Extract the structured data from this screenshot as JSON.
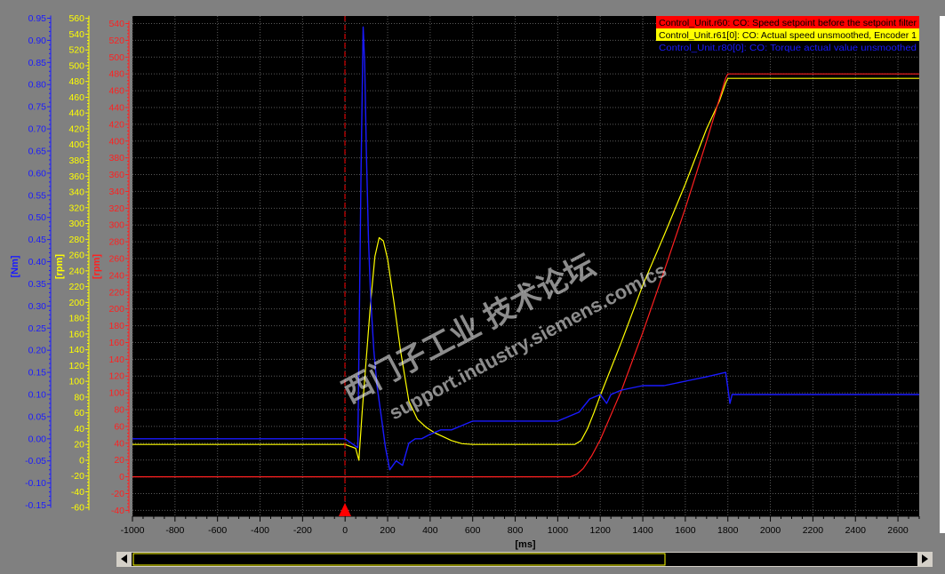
{
  "colors": {
    "background": "#808080",
    "plot_bg": "#000000",
    "grid": "#5a5a5a",
    "torque_axis": "#1a1aff",
    "speed_axis": "#ffff00",
    "setpoint_axis": "#ff2020",
    "trigger": "#ff0000",
    "scrollbar_thumb": "#000000",
    "scrollbar_frame": "#ffff00"
  },
  "axes": {
    "torque_unit": "[Nm]",
    "speed_unit": "[rpm]",
    "setpoint_unit": "[rpm]",
    "x_unit": "[ms]"
  },
  "chart_data": {
    "type": "line",
    "title": "",
    "xlabel": "[ms]",
    "xlim": [
      -1000,
      2700
    ],
    "x_ticks": [
      -1000,
      -800,
      -600,
      -400,
      -200,
      0,
      200,
      400,
      600,
      800,
      1000,
      1200,
      1400,
      1600,
      1800,
      2000,
      2200,
      2400,
      2600
    ],
    "grid": true,
    "legend_position": "top-right",
    "trigger_x": 0,
    "y_axes": [
      {
        "id": "nm",
        "label": "[Nm]",
        "ylim": [
          -0.175,
          0.955
        ],
        "ticks": [
          -0.15,
          -0.1,
          -0.05,
          0.0,
          0.05,
          0.1,
          0.15,
          0.2,
          0.25,
          0.3,
          0.35,
          0.4,
          0.45,
          0.5,
          0.55,
          0.6,
          0.65,
          0.7,
          0.75,
          0.8,
          0.85,
          0.9,
          0.95
        ],
        "decimals": 2
      },
      {
        "id": "rpm_y",
        "label": "[rpm]",
        "ylim": [
          -71,
          563
        ],
        "ticks": [
          -60,
          -40,
          -20,
          0,
          20,
          40,
          60,
          80,
          100,
          120,
          140,
          160,
          180,
          200,
          220,
          240,
          260,
          280,
          300,
          320,
          340,
          360,
          380,
          400,
          420,
          440,
          460,
          480,
          500,
          520,
          540,
          560
        ],
        "decimals": 0
      },
      {
        "id": "rpm_r",
        "label": "[rpm]",
        "ylim": [
          -47,
          549
        ],
        "ticks": [
          -40,
          -20,
          0,
          20,
          40,
          60,
          80,
          100,
          120,
          140,
          160,
          180,
          200,
          220,
          240,
          260,
          280,
          300,
          320,
          340,
          360,
          380,
          400,
          420,
          440,
          460,
          480,
          500,
          520,
          540
        ],
        "decimals": 0
      }
    ],
    "series": [
      {
        "name": "Control_Unit.r60: CO: Speed setpoint before the setpoint filter",
        "axis": "rpm_r",
        "color": "#ff2020",
        "x": [
          -1000,
          1060,
          1090,
          1120,
          1160,
          1200,
          1300,
          1400,
          1500,
          1600,
          1700,
          1790,
          1800,
          2700
        ],
        "y": [
          0,
          0,
          3,
          10,
          25,
          44,
          103,
          172,
          245,
          320,
          400,
          475,
          480,
          480
        ]
      },
      {
        "name": "Control_Unit.r61[0]: CO: Actual speed unsmoothed, Encoder 1",
        "axis": "rpm_y",
        "color": "#ffff00",
        "x": [
          -1000,
          0,
          50,
          65,
          80,
          100,
          120,
          140,
          160,
          180,
          200,
          230,
          260,
          300,
          340,
          380,
          420,
          460,
          500,
          550,
          600,
          700,
          800,
          900,
          1000,
          1080,
          1110,
          1140,
          1170,
          1200,
          1300,
          1400,
          1500,
          1600,
          1700,
          1760,
          1790,
          1800,
          2700
        ],
        "y": [
          20,
          20,
          15,
          0,
          60,
          130,
          200,
          258,
          282,
          278,
          255,
          200,
          140,
          75,
          52,
          42,
          35,
          30,
          25,
          21,
          20,
          20,
          20,
          20,
          20,
          20,
          25,
          40,
          60,
          82,
          150,
          222,
          285,
          350,
          420,
          455,
          478,
          484,
          484
        ]
      },
      {
        "name": "Control_Unit.r80[0]: CO: Torque actual value unsmoothed",
        "axis": "nm",
        "color": "#1a1aff",
        "x": [
          -1000,
          0,
          60,
          75,
          85,
          92,
          100,
          110,
          120,
          135,
          150,
          170,
          190,
          210,
          240,
          270,
          300,
          330,
          360,
          400,
          450,
          500,
          550,
          600,
          700,
          800,
          900,
          1000,
          1050,
          1100,
          1150,
          1200,
          1230,
          1250,
          1300,
          1400,
          1500,
          1600,
          1700,
          1790,
          1810,
          1820,
          1900,
          2000,
          2200,
          2400,
          2600,
          2700
        ],
        "y": [
          0.0,
          0.0,
          -0.02,
          0.6,
          0.93,
          0.85,
          0.65,
          0.45,
          0.32,
          0.2,
          0.12,
          0.05,
          -0.02,
          -0.07,
          -0.05,
          -0.06,
          -0.01,
          0.0,
          0.0,
          0.01,
          0.02,
          0.02,
          0.03,
          0.04,
          0.04,
          0.04,
          0.04,
          0.04,
          0.05,
          0.06,
          0.09,
          0.1,
          0.08,
          0.1,
          0.11,
          0.12,
          0.12,
          0.13,
          0.14,
          0.15,
          0.08,
          0.1,
          0.1,
          0.1,
          0.1,
          0.1,
          0.1,
          0.1
        ]
      }
    ],
    "annotations": [
      "西门子工业 技术论坛",
      "support.industry.siemens.com/cs"
    ]
  }
}
